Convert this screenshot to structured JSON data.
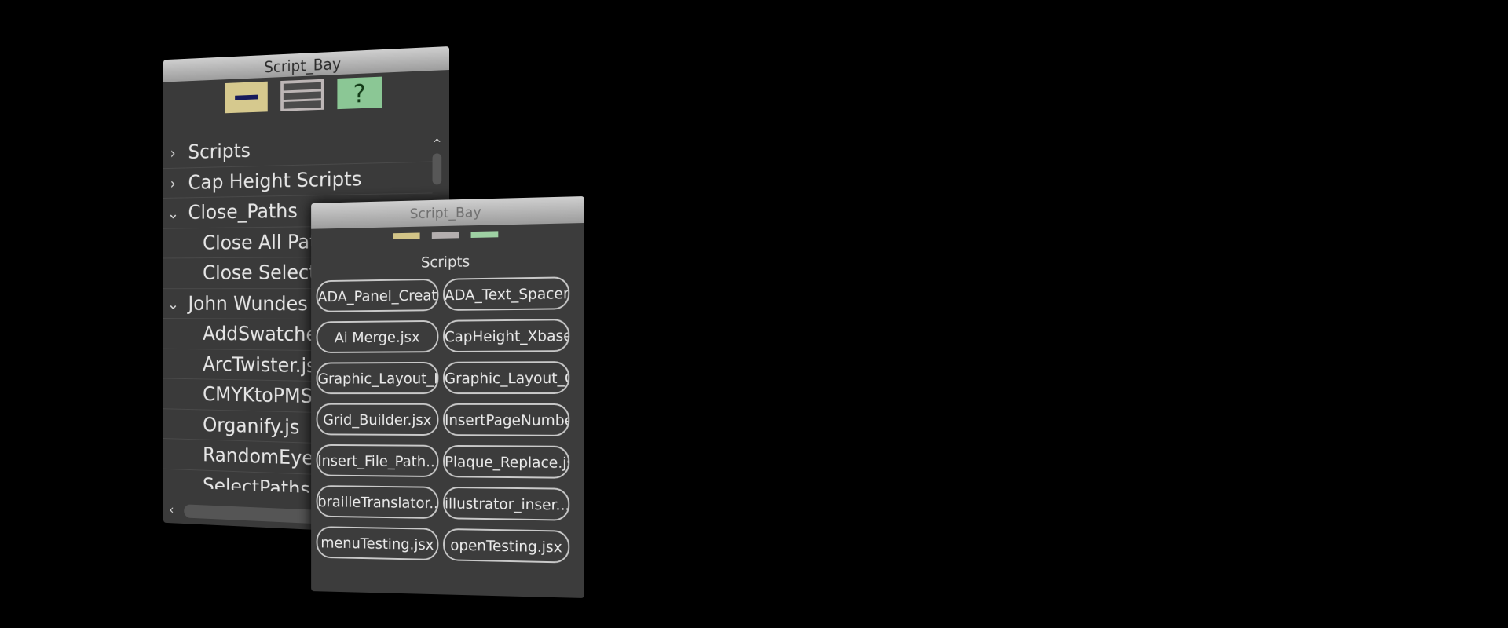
{
  "back_panel": {
    "title": "Script_Bay",
    "toolbar": {
      "collapse_icon": "collapse-all-icon",
      "expand_icon": "expand-all-icon",
      "help_label": "?"
    },
    "tree": [
      {
        "label": "Scripts",
        "chevron": "›",
        "level": 0
      },
      {
        "label": "Cap Height Scripts",
        "chevron": "›",
        "level": 0
      },
      {
        "label": "Close_Paths",
        "chevron": "⌄",
        "level": 0
      },
      {
        "label": "Close All Paths.jsx",
        "chevron": "",
        "level": 1
      },
      {
        "label": "Close Selected Paths.jsx",
        "chevron": "",
        "level": 1
      },
      {
        "label": "John Wundes Scripts",
        "chevron": "⌄",
        "level": 0
      },
      {
        "label": "AddSwatches.jsx",
        "chevron": "",
        "level": 1
      },
      {
        "label": "ArcTwister.jsx",
        "chevron": "",
        "level": 1
      },
      {
        "label": "CMYKtoPMS.jsx",
        "chevron": "",
        "level": 1
      },
      {
        "label": "Organify.js",
        "chevron": "",
        "level": 1
      },
      {
        "label": "RandomEyes.jsx",
        "chevron": "",
        "level": 1
      },
      {
        "label": "SelectPathsBySize.jsx",
        "chevron": "",
        "level": 1
      }
    ],
    "scroll": {
      "up": "^",
      "left": "<"
    }
  },
  "front_panel": {
    "title": "Script_Bay",
    "section_title": "Scripts",
    "buttons": [
      "ADA_Panel_Creator...",
      "ADA_Text_Spacer.j...",
      "Ai Merge.jsx",
      "CapHeight_Xbased...",
      "Graphic_Layout_Da...",
      "Graphic_Layout_Gr...",
      "Grid_Builder.jsx",
      "InsertPageNumber...",
      "Insert_File_Path....",
      "Plaque_Replace.js...",
      "brailleTranslator...",
      "illustrator_inser...",
      "menuTesting.jsx",
      "openTesting.jsx"
    ]
  },
  "colors": {
    "background": "#000000",
    "panel": "#3a3a3a",
    "collapse_button": "#d6c98e",
    "expand_button": "#bdb6b6",
    "help_button": "#8bc795"
  }
}
